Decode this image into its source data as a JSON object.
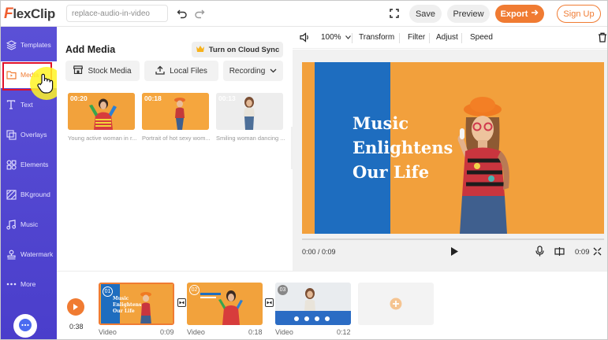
{
  "app": {
    "logo_mark": "F",
    "logo_text": "lexClip"
  },
  "topbar": {
    "project_name": "replace-audio-in-video",
    "save_label": "Save",
    "preview_label": "Preview",
    "export_label": "Export",
    "signup_label": "Sign Up"
  },
  "sidebar": {
    "items": [
      {
        "label": "Templates",
        "icon": "templates-icon"
      },
      {
        "label": "Media",
        "icon": "media-folder-icon",
        "active": true
      },
      {
        "label": "Text",
        "icon": "text-icon"
      },
      {
        "label": "Overlays",
        "icon": "overlays-icon"
      },
      {
        "label": "Elements",
        "icon": "elements-icon"
      },
      {
        "label": "BKground",
        "icon": "background-icon"
      },
      {
        "label": "Music",
        "icon": "music-icon"
      },
      {
        "label": "Watermark",
        "icon": "watermark-icon"
      },
      {
        "label": "More",
        "icon": "more-icon"
      }
    ]
  },
  "media_panel": {
    "title": "Add Media",
    "cloud_sync_label": "Turn on Cloud Sync",
    "source_buttons": [
      "Stock Media",
      "Local Files",
      "Recording"
    ],
    "items": [
      {
        "duration": "00:20",
        "caption": "Young active woman in r..."
      },
      {
        "duration": "00:18",
        "caption": "Portrait of hot sexy wom..."
      },
      {
        "duration": "00:13",
        "caption": "Smiling woman dancing ..."
      }
    ]
  },
  "preview_toolbar": {
    "zoom": "100%",
    "items": [
      "Transform",
      "Filter",
      "Adjust",
      "Speed"
    ]
  },
  "preview": {
    "overlay_text": [
      "Music",
      "Enlightens",
      "Our Life"
    ],
    "current_time": "0:00 / 0:09",
    "end_time": "0:09"
  },
  "timeline": {
    "total_time": "0:38",
    "clips": [
      {
        "number": "01",
        "label": "Video",
        "duration": "0:09",
        "overlay": [
          "Music",
          "Enlightens",
          "Our Life"
        ]
      },
      {
        "number": "02",
        "label": "Video",
        "duration": "0:18"
      },
      {
        "number": "03",
        "label": "Video",
        "duration": "0:12"
      }
    ]
  },
  "colors": {
    "accent": "#f07b32",
    "sidebar": "#5b50d6",
    "preview_blue": "#1e6dbf",
    "preview_orange": "#f2a03c",
    "highlight_box": "#e0102a"
  }
}
